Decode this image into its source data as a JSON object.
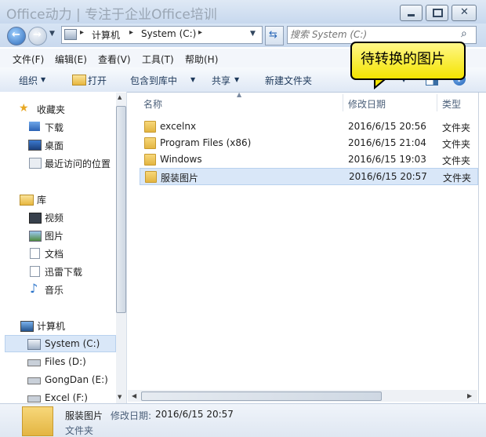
{
  "window": {
    "title": "Office动力 | 专注于企业Office培训"
  },
  "address": {
    "crumbs": [
      "计算机",
      "System (C:)"
    ]
  },
  "search": {
    "placeholder": "搜索 System (C:)"
  },
  "menu": {
    "items": [
      "文件(F)",
      "编辑(E)",
      "查看(V)",
      "工具(T)",
      "帮助(H)"
    ]
  },
  "toolbar": {
    "organize": "组织",
    "open": "打开",
    "include": "包含到库中",
    "share": "共享",
    "new_folder": "新建文件夹"
  },
  "nav": {
    "favorites": {
      "label": "收藏夹",
      "items": [
        "下载",
        "桌面",
        "最近访问的位置"
      ]
    },
    "libraries": {
      "label": "库",
      "items": [
        "视频",
        "图片",
        "文档",
        "迅雷下载",
        "音乐"
      ]
    },
    "computer": {
      "label": "计算机",
      "items": [
        "System (C:)",
        "Files (D:)",
        "GongDan (E:)",
        "Excel (F:)"
      ]
    }
  },
  "columns": {
    "name": "名称",
    "date": "修改日期",
    "type": "类型"
  },
  "files": [
    {
      "name": "excelnx",
      "date": "2016/6/15 20:56",
      "type": "文件夹"
    },
    {
      "name": "Program Files (x86)",
      "date": "2016/6/15 21:04",
      "type": "文件夹"
    },
    {
      "name": "Windows",
      "date": "2016/6/15 19:03",
      "type": "文件夹"
    },
    {
      "name": "服装图片",
      "date": "2016/6/15 20:57",
      "type": "文件夹"
    }
  ],
  "callout": {
    "text": "待转换的图片"
  },
  "details": {
    "name": "服装图片",
    "date_label": "修改日期:",
    "date": "2016/6/15 20:57",
    "type": "文件夹"
  },
  "colors": {
    "accent": "#3a6ea5",
    "selected_row": "#d9e7f8",
    "callout": "#f4e400"
  }
}
